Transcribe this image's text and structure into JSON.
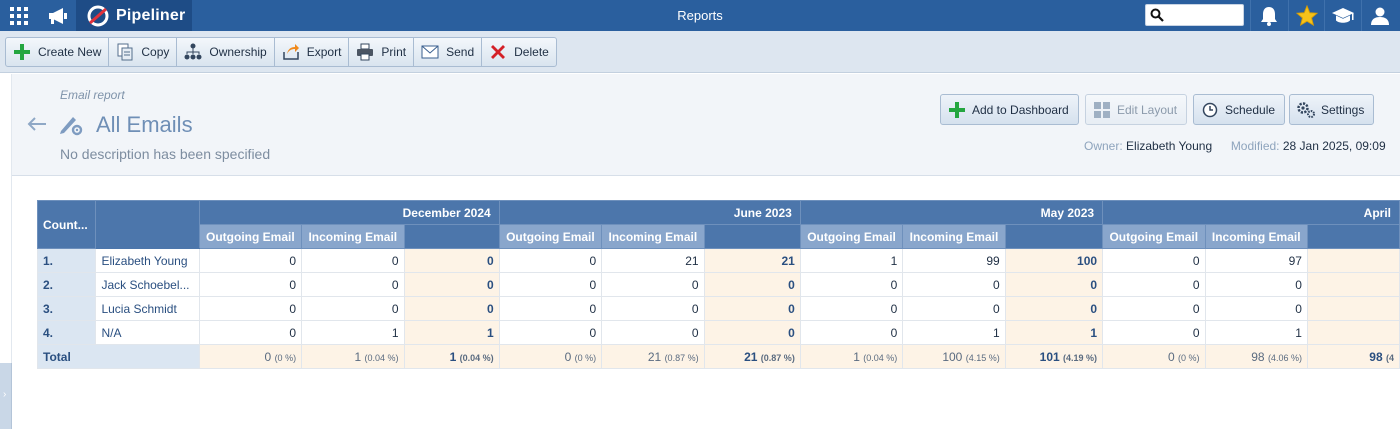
{
  "topbar": {
    "brand": "Pipeliner",
    "title": "Reports",
    "search": {
      "value": "",
      "placeholder": ""
    }
  },
  "toolbar": {
    "buttons": [
      {
        "label": "Create New",
        "icon": "plus-icon"
      },
      {
        "label": "Copy",
        "icon": "copy-icon"
      },
      {
        "label": "Ownership",
        "icon": "hierarchy-icon"
      },
      {
        "label": "Export",
        "icon": "export-icon"
      },
      {
        "label": "Print",
        "icon": "printer-icon"
      },
      {
        "label": "Send",
        "icon": "envelope-icon"
      },
      {
        "label": "Delete",
        "icon": "delete-x-icon"
      }
    ]
  },
  "header": {
    "subtitle": "Email report",
    "title": "All Emails",
    "description": "No description has been specified",
    "buttons": {
      "add_dashboard": "Add to Dashboard",
      "edit_layout": "Edit Layout",
      "schedule": "Schedule",
      "settings": "Settings"
    },
    "owner_label": "Owner:",
    "owner": "Elizabeth Young",
    "modified_label": "Modified:",
    "modified": "28 Jan 2025, 09:09"
  },
  "table": {
    "col1_header": "Count...",
    "months": [
      "December 2024",
      "June 2023",
      "May 2023",
      "April"
    ],
    "sub_headers": {
      "outgoing": "Outgoing Email",
      "incoming": "Incoming Email"
    },
    "rows": [
      {
        "num": "1.",
        "name": "Elizabeth Young",
        "cells": [
          "0",
          "0",
          "0",
          "0",
          "21",
          "21",
          "1",
          "99",
          "100",
          "0",
          "97",
          ""
        ]
      },
      {
        "num": "2.",
        "name": "Jack Schoebel...",
        "cells": [
          "0",
          "0",
          "0",
          "0",
          "0",
          "0",
          "0",
          "0",
          "0",
          "0",
          "0",
          ""
        ]
      },
      {
        "num": "3.",
        "name": "Lucia Schmidt",
        "cells": [
          "0",
          "0",
          "0",
          "0",
          "0",
          "0",
          "0",
          "0",
          "0",
          "0",
          "0",
          ""
        ]
      },
      {
        "num": "4.",
        "name": "N/A",
        "cells": [
          "0",
          "1",
          "1",
          "0",
          "0",
          "0",
          "0",
          "1",
          "1",
          "0",
          "1",
          ""
        ]
      }
    ],
    "total": {
      "label": "Total",
      "cells": [
        {
          "v": "0",
          "p": "(0 %)"
        },
        {
          "v": "1",
          "p": "(0.04 %)"
        },
        {
          "v": "1",
          "p": "(0.04 %)"
        },
        {
          "v": "0",
          "p": "(0 %)"
        },
        {
          "v": "21",
          "p": "(0.87 %)"
        },
        {
          "v": "21",
          "p": "(0.87 %)"
        },
        {
          "v": "1",
          "p": "(0.04 %)"
        },
        {
          "v": "100",
          "p": "(4.15 %)"
        },
        {
          "v": "101",
          "p": "(4.19 %)"
        },
        {
          "v": "0",
          "p": "(0 %)"
        },
        {
          "v": "98",
          "p": "(4.06 %)"
        },
        {
          "v": "98",
          "p": "(4"
        }
      ]
    }
  },
  "colors": {
    "topbar": "#2a5f9e",
    "brand_bg": "#1e4c86",
    "table_header": "#4c76ab",
    "table_subheader": "#89a6cc",
    "total_fill": "#fdf3e6"
  }
}
